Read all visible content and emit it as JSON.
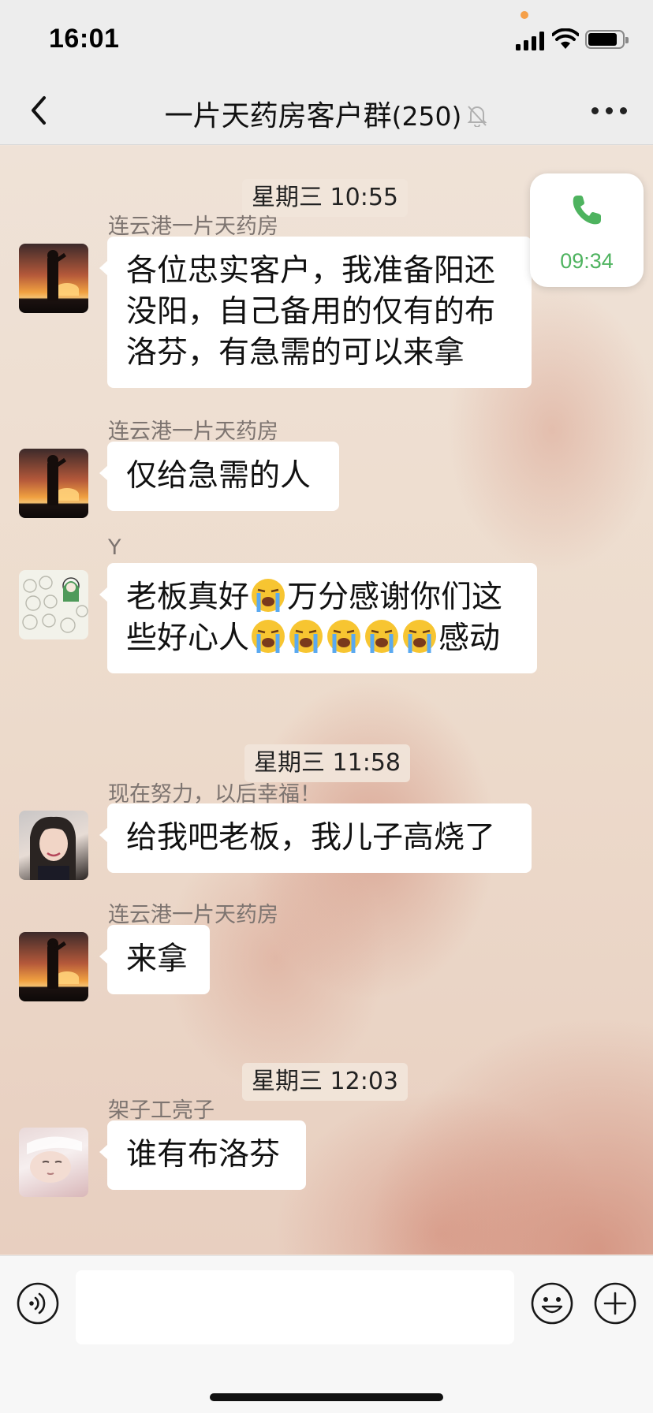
{
  "status_bar": {
    "time": "16:01"
  },
  "nav": {
    "title": "一片天药房客户群",
    "member_count": "(250)"
  },
  "call": {
    "duration": "09:34"
  },
  "messages": [
    {
      "type": "time",
      "text": "星期三 10:55"
    },
    {
      "type": "msg",
      "sender": "连云港一片天药房",
      "avatar": "salute-sunset",
      "text": "各位忠实客户，我准备阳还没阳，自己备用的仅有的布洛芬，有急需的可以来拿"
    },
    {
      "type": "msg",
      "sender": "连云港一片天药房",
      "avatar": "salute-sunset",
      "text": "仅给急需的人"
    },
    {
      "type": "msg",
      "sender": "Y",
      "avatar": "sheep-drawing",
      "text_parts": [
        "老板真好",
        "万分感谢你们这",
        "些好心人",
        "感动"
      ],
      "emoji": "loudly-crying-face-emoji"
    },
    {
      "type": "time",
      "text": "星期三 11:58"
    },
    {
      "type": "msg",
      "sender": "现在努力，以后幸福！",
      "avatar": "girl-photo",
      "text": "给我吧老板，我儿子高烧了"
    },
    {
      "type": "msg",
      "sender": "连云港一片天药房",
      "avatar": "salute-sunset",
      "text": "来拿"
    },
    {
      "type": "time",
      "text": "星期三 12:03"
    },
    {
      "type": "msg",
      "sender": "架子工亮子",
      "avatar": "sleeping-child-photo",
      "text": "谁有布洛芬"
    }
  ],
  "input": {
    "value": "",
    "placeholder": ""
  },
  "icons": {
    "back": "chevron-left-icon",
    "mute": "bell-slash-icon",
    "more": "more-dots-icon",
    "phone": "phone-icon",
    "voice": "voice-input-icon",
    "emoji": "smiley-icon",
    "plus": "plus-icon"
  },
  "colors": {
    "call_green": "#4eb35f",
    "bubble": "#ffffff",
    "nav_bg": "#ededed"
  }
}
